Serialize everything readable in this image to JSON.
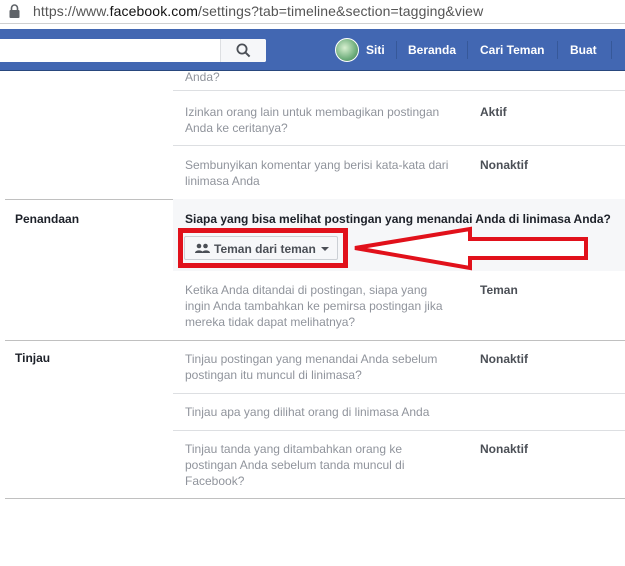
{
  "address_bar": {
    "url_prefix": "https://www.",
    "url_domain": "facebook.com",
    "url_path": "/settings?tab=timeline&section=tagging&view"
  },
  "topnav": {
    "user_name": "Siti",
    "home": "Beranda",
    "find_friends": "Cari Teman",
    "create": "Buat"
  },
  "settings": {
    "partial_top_text": "Anda?",
    "rows_top": [
      {
        "text_lines": [
          "Izinkan orang lain untuk membagikan postingan",
          "Anda ke ceritanya?"
        ],
        "value": "Aktif"
      },
      {
        "text_lines": [
          "Sembunyikan komentar yang berisi kata-kata dari",
          "linimasa Anda"
        ],
        "value": "Nonaktif"
      }
    ],
    "tagging": {
      "section_title": "Penandaan",
      "question": "Siapa yang bisa melihat postingan yang menandai Anda di linimasa Anda?",
      "dropdown_value": "Teman dari teman",
      "row": {
        "text_lines": [
          "Ketika Anda ditandai di postingan, siapa yang",
          "ingin Anda tambahkan ke pemirsa postingan jika",
          "mereka tidak dapat melihatnya?"
        ],
        "value": "Teman"
      }
    },
    "review": {
      "section_title": "Tinjau",
      "rows": [
        {
          "text_lines": [
            "Tinjau postingan yang menandai Anda sebelum",
            "postingan itu muncul di linimasa?"
          ],
          "value": "Nonaktif"
        },
        {
          "text_lines": [
            "Tinjau apa yang dilihat orang di linimasa Anda"
          ],
          "value": ""
        },
        {
          "text_lines": [
            "Tinjau tanda yang ditambahkan orang ke",
            "postingan Anda sebelum tanda muncul di",
            "Facebook?"
          ],
          "value": "Nonaktif"
        }
      ]
    }
  },
  "colors": {
    "fb_blue": "#4267b2",
    "annotation_red": "#e1111b"
  },
  "icons": [
    "lock-icon",
    "search-icon",
    "people-icon",
    "caret-down-icon",
    "red-arrow-annotation"
  ]
}
